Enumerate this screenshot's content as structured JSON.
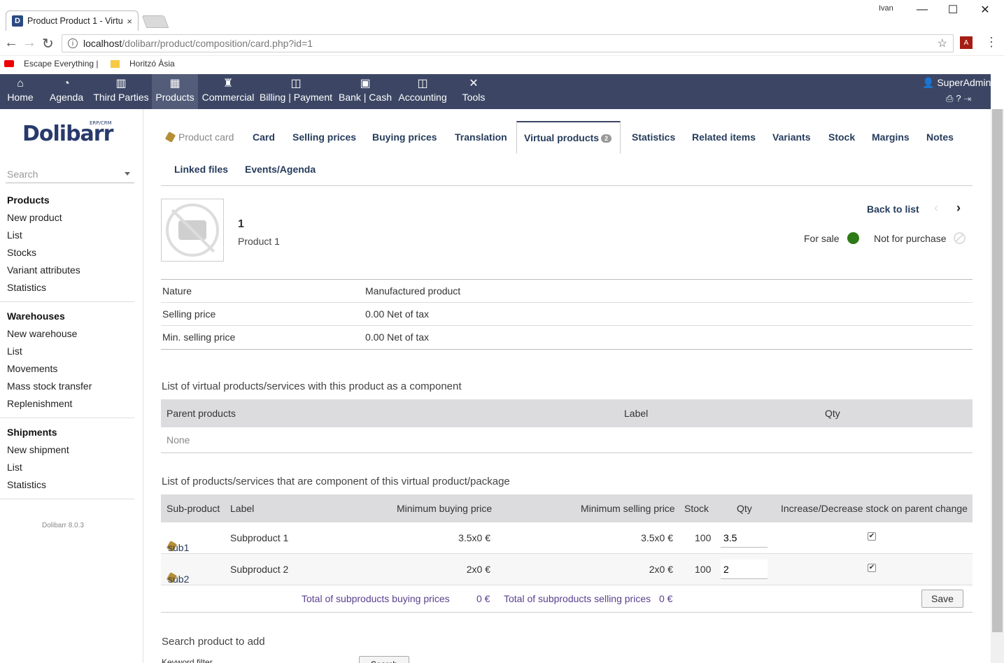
{
  "browser": {
    "tab_title": "Product Product 1 - Virtu",
    "tab_close": "×",
    "favicon": "D",
    "user_chip": "Ivan",
    "url_host": "localhost",
    "url_path": "/dolibarr/product/composition/card.php?id=1",
    "bookmarks": [
      "Escape Everything | ",
      "Horitzó Àsia"
    ],
    "controls": {
      "minimize": "—",
      "maximize": "☐",
      "close": "✕",
      "back": "←",
      "forward": "→",
      "reload": "↻",
      "star": "☆",
      "info": "i",
      "pdf": "A",
      "menu": "⋮"
    }
  },
  "topmenu": {
    "items": [
      {
        "label": "Home",
        "icon": "home-icon",
        "glyph": "⌂"
      },
      {
        "label": "Agenda",
        "icon": "agenda-icon",
        "glyph": "◔"
      },
      {
        "label": "Third Parties",
        "icon": "building-icon",
        "glyph": "▥"
      },
      {
        "label": "Products",
        "icon": "cubes-icon",
        "glyph": "▦"
      },
      {
        "label": "Commercial",
        "icon": "suitcase-icon",
        "glyph": "♜"
      },
      {
        "label": "Billing | Payment",
        "icon": "coins-icon",
        "glyph": "◫"
      },
      {
        "label": "Bank | Cash",
        "icon": "safe-icon",
        "glyph": "▣"
      },
      {
        "label": "Accounting",
        "icon": "ledger-icon",
        "glyph": "◫"
      },
      {
        "label": "Tools",
        "icon": "tools-icon",
        "glyph": "✕"
      }
    ],
    "active": "Products",
    "login": "SuperAdmin",
    "login_icons": "⎙?⇥"
  },
  "leftmenu": {
    "logo": "Dolibarr",
    "logo_sub": "ERP/CRM",
    "search_placeholder": "Search",
    "sections": [
      {
        "title": "Products",
        "items": [
          "New product",
          "List",
          "Stocks",
          "Variant attributes",
          "Statistics"
        ]
      },
      {
        "title": "Warehouses",
        "items": [
          "New warehouse",
          "List",
          "Movements",
          "Mass stock transfer",
          "Replenishment"
        ]
      },
      {
        "title": "Shipments",
        "items": [
          "New shipment",
          "List",
          "Statistics"
        ]
      }
    ],
    "version": "Dolibarr 8.0.3"
  },
  "tabs": {
    "product_card": "Product card",
    "items": [
      "Card",
      "Selling prices",
      "Buying prices",
      "Translation",
      "Virtual products",
      "Statistics",
      "Related items",
      "Variants",
      "Stock",
      "Margins",
      "Notes",
      "Linked files",
      "Events/Agenda"
    ],
    "active": "Virtual products",
    "virtual_badge": "2"
  },
  "product": {
    "ref": "1",
    "label": "Product 1",
    "back_to_list": "Back to list",
    "prev": "‹",
    "next": "›",
    "for_sale": "For sale",
    "not_for_purchase": "Not for purchase"
  },
  "attributes": [
    {
      "key": "Nature",
      "value": "Manufactured product"
    },
    {
      "key": "Selling price",
      "value": "0.00 Net of tax"
    },
    {
      "key": "Min. selling price",
      "value": "0.00 Net of tax"
    }
  ],
  "parents": {
    "title": "List of virtual products/services with this product as a component",
    "headers": [
      "Parent products",
      "Label",
      "Qty"
    ],
    "empty": "None"
  },
  "components": {
    "title": "List of products/services that are component of this virtual product/package",
    "headers": [
      "Sub-product",
      "Label",
      "Minimum buying price",
      "Minimum selling price",
      "Stock",
      "Qty",
      "Increase/Decrease stock on parent change"
    ],
    "rows": [
      {
        "ref": "sub1",
        "label": "Subproduct 1",
        "min_buy": "3.5x0 €",
        "min_sell": "3.5x0 €",
        "stock": "100",
        "qty": "3.5",
        "check": "✔"
      },
      {
        "ref": "sub2",
        "label": "Subproduct 2",
        "min_buy": "2x0 €",
        "min_sell": "2x0 €",
        "stock": "100",
        "qty": "2",
        "check": "✔"
      }
    ],
    "total_buy_label": "Total of subproducts buying prices",
    "total_buy": "0 €",
    "total_sell_label": "Total of subproducts selling prices",
    "total_sell": "0 €",
    "save": "Save"
  },
  "add": {
    "title": "Search product to add",
    "keyword_label": "Keyword filter",
    "search_button": "Search"
  }
}
